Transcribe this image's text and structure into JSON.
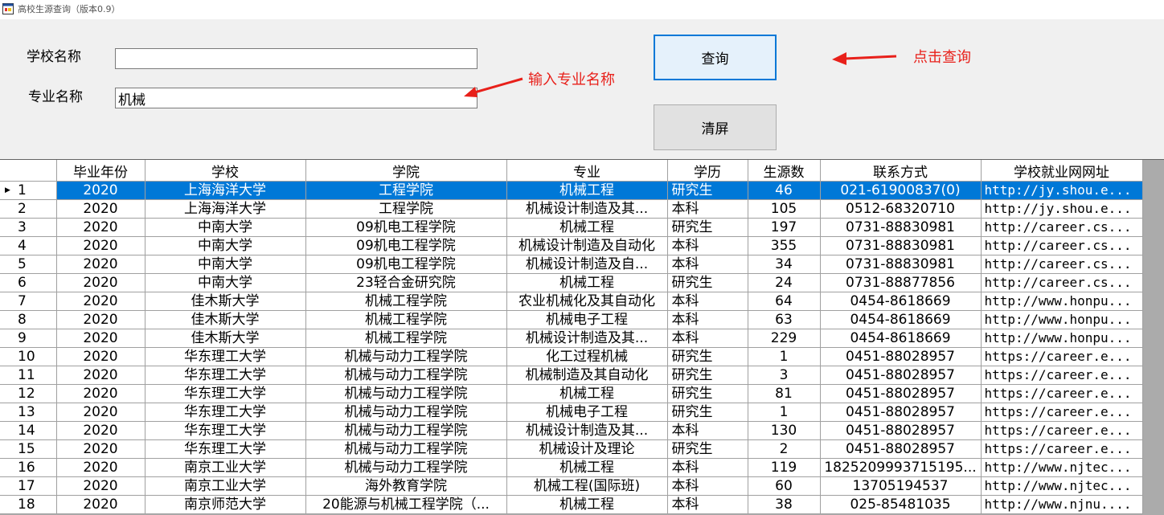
{
  "window": {
    "title": "高校生源查询（版本0.9）"
  },
  "form": {
    "school_label": "学校名称",
    "school_value": "",
    "major_label": "专业名称",
    "major_value": "机械",
    "query_button": "查询",
    "clear_button": "清屏"
  },
  "annotations": {
    "input_hint": "输入专业名称",
    "click_hint": "点击查询",
    "color": "#e8201a"
  },
  "colors": {
    "selection": "#0078d7",
    "button_focus_border": "#0078d7"
  },
  "table": {
    "columns": [
      "",
      "毕业年份",
      "学校",
      "学院",
      "专业",
      "学历",
      "生源数",
      "联系方式",
      "学校就业网网址"
    ],
    "selected_row": 0,
    "rows": [
      [
        "1",
        "2020",
        "上海海洋大学",
        "工程学院",
        "机械工程",
        "研究生",
        "46",
        "021-61900837(0)",
        "http://jy.shou.e..."
      ],
      [
        "2",
        "2020",
        "上海海洋大学",
        "工程学院",
        "机械设计制造及其...",
        "本科",
        "105",
        "0512-68320710",
        "http://jy.shou.e..."
      ],
      [
        "3",
        "2020",
        "中南大学",
        "09机电工程学院",
        "机械工程",
        "研究生",
        "197",
        "0731-88830981",
        "http://career.cs..."
      ],
      [
        "4",
        "2020",
        "中南大学",
        "09机电工程学院",
        "机械设计制造及自动化",
        "本科",
        "355",
        "0731-88830981",
        "http://career.cs..."
      ],
      [
        "5",
        "2020",
        "中南大学",
        "09机电工程学院",
        "机械设计制造及自...",
        "本科",
        "34",
        "0731-88830981",
        "http://career.cs..."
      ],
      [
        "6",
        "2020",
        "中南大学",
        "23轻合金研究院",
        "机械工程",
        "研究生",
        "24",
        "0731-88877856",
        "http://career.cs..."
      ],
      [
        "7",
        "2020",
        "佳木斯大学",
        "机械工程学院",
        "农业机械化及其自动化",
        "本科",
        "64",
        "0454-8618669",
        "http://www.honpu..."
      ],
      [
        "8",
        "2020",
        "佳木斯大学",
        "机械工程学院",
        "机械电子工程",
        "本科",
        "63",
        "0454-8618669",
        "http://www.honpu..."
      ],
      [
        "9",
        "2020",
        "佳木斯大学",
        "机械工程学院",
        "机械设计制造及其...",
        "本科",
        "229",
        "0454-8618669",
        "http://www.honpu..."
      ],
      [
        "10",
        "2020",
        "华东理工大学",
        "机械与动力工程学院",
        "化工过程机械",
        "研究生",
        "1",
        "0451-88028957",
        "https://career.e..."
      ],
      [
        "11",
        "2020",
        "华东理工大学",
        "机械与动力工程学院",
        "机械制造及其自动化",
        "研究生",
        "3",
        "0451-88028957",
        "https://career.e..."
      ],
      [
        "12",
        "2020",
        "华东理工大学",
        "机械与动力工程学院",
        "机械工程",
        "研究生",
        "81",
        "0451-88028957",
        "https://career.e..."
      ],
      [
        "13",
        "2020",
        "华东理工大学",
        "机械与动力工程学院",
        "机械电子工程",
        "研究生",
        "1",
        "0451-88028957",
        "https://career.e..."
      ],
      [
        "14",
        "2020",
        "华东理工大学",
        "机械与动力工程学院",
        "机械设计制造及其...",
        "本科",
        "130",
        "0451-88028957",
        "https://career.e..."
      ],
      [
        "15",
        "2020",
        "华东理工大学",
        "机械与动力工程学院",
        "机械设计及理论",
        "研究生",
        "2",
        "0451-88028957",
        "https://career.e..."
      ],
      [
        "16",
        "2020",
        "南京工业大学",
        "机械与动力工程学院",
        "机械工程",
        "本科",
        "119",
        "1825209993715195...",
        "http://www.njtec..."
      ],
      [
        "17",
        "2020",
        "南京工业大学",
        "海外教育学院",
        "机械工程(国际班)",
        "本科",
        "60",
        "13705194537",
        "http://www.njtec..."
      ],
      [
        "18",
        "2020",
        "南京师范大学",
        "20能源与机械工程学院（...",
        "机械工程",
        "本科",
        "38",
        "025-85481035",
        "http://www.njnu...."
      ]
    ]
  }
}
